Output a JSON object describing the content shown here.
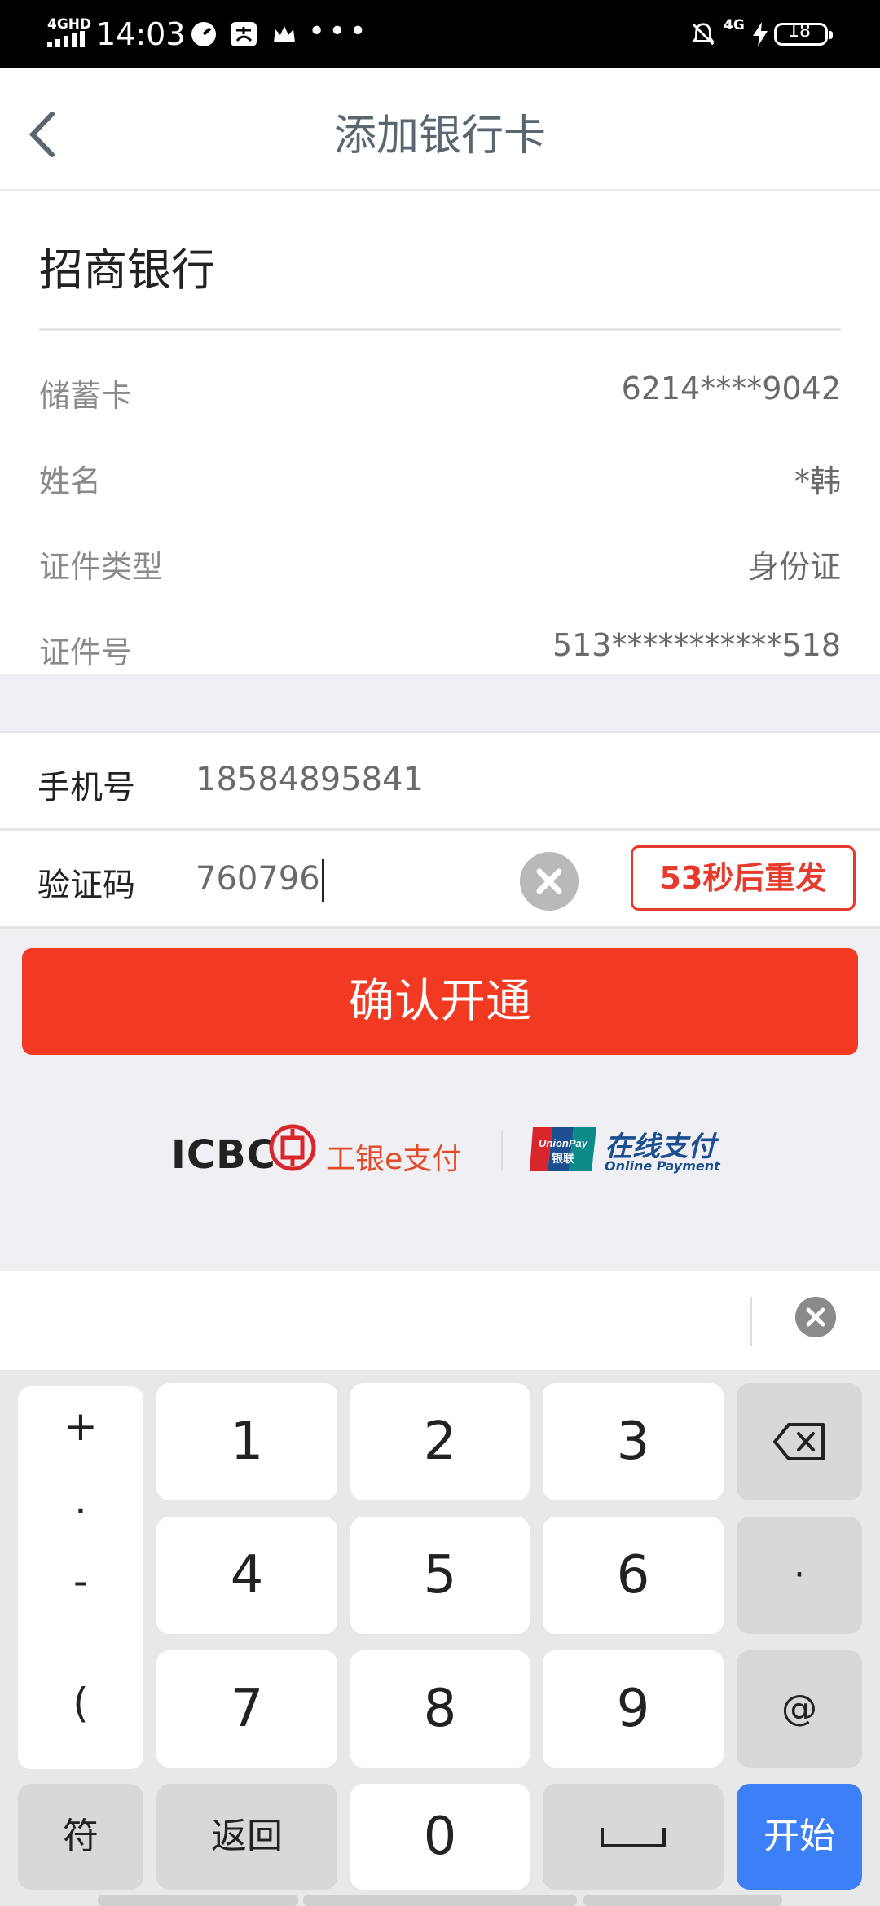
{
  "status_bar": {
    "network_type": "4GHD",
    "time": "14:03",
    "network_type_2": "4G",
    "battery": "18"
  },
  "header": {
    "title": "添加银行卡"
  },
  "card": {
    "bank_name": "招商银行",
    "rows": [
      {
        "label": "储蓄卡",
        "value": "6214****9042"
      },
      {
        "label": "姓名",
        "value": "*韩"
      },
      {
        "label": "证件类型",
        "value": "身份证"
      },
      {
        "label": "证件号",
        "value": "513***********518"
      }
    ]
  },
  "form": {
    "phone_label": "手机号",
    "phone_value": "18584895841",
    "code_label": "验证码",
    "code_value": "760796",
    "resend_label": "53秒后重发"
  },
  "confirm_label": "确认开通",
  "logos": {
    "icbc_text": "ICBC",
    "icbc_cn": "工银e支付",
    "unionpay_badge_text": "UnionPay",
    "unionpay_badge_cn": "银联",
    "unionpay_cn": "在线支付",
    "unionpay_en": "Online Payment"
  },
  "keyboard": {
    "symbols": [
      "+",
      ".",
      "-",
      "("
    ],
    "keys": [
      "1",
      "2",
      "3",
      "4",
      "5",
      "6",
      "7",
      "8",
      "9",
      "0"
    ],
    "dot": "·",
    "at": "@",
    "symbol_key": "符",
    "back_key": "返回",
    "start_key": "开始"
  },
  "colors": {
    "accent": "#f23a22",
    "resend": "#e63a2c",
    "start_key": "#3d7ff6",
    "background": "#efeff4"
  }
}
